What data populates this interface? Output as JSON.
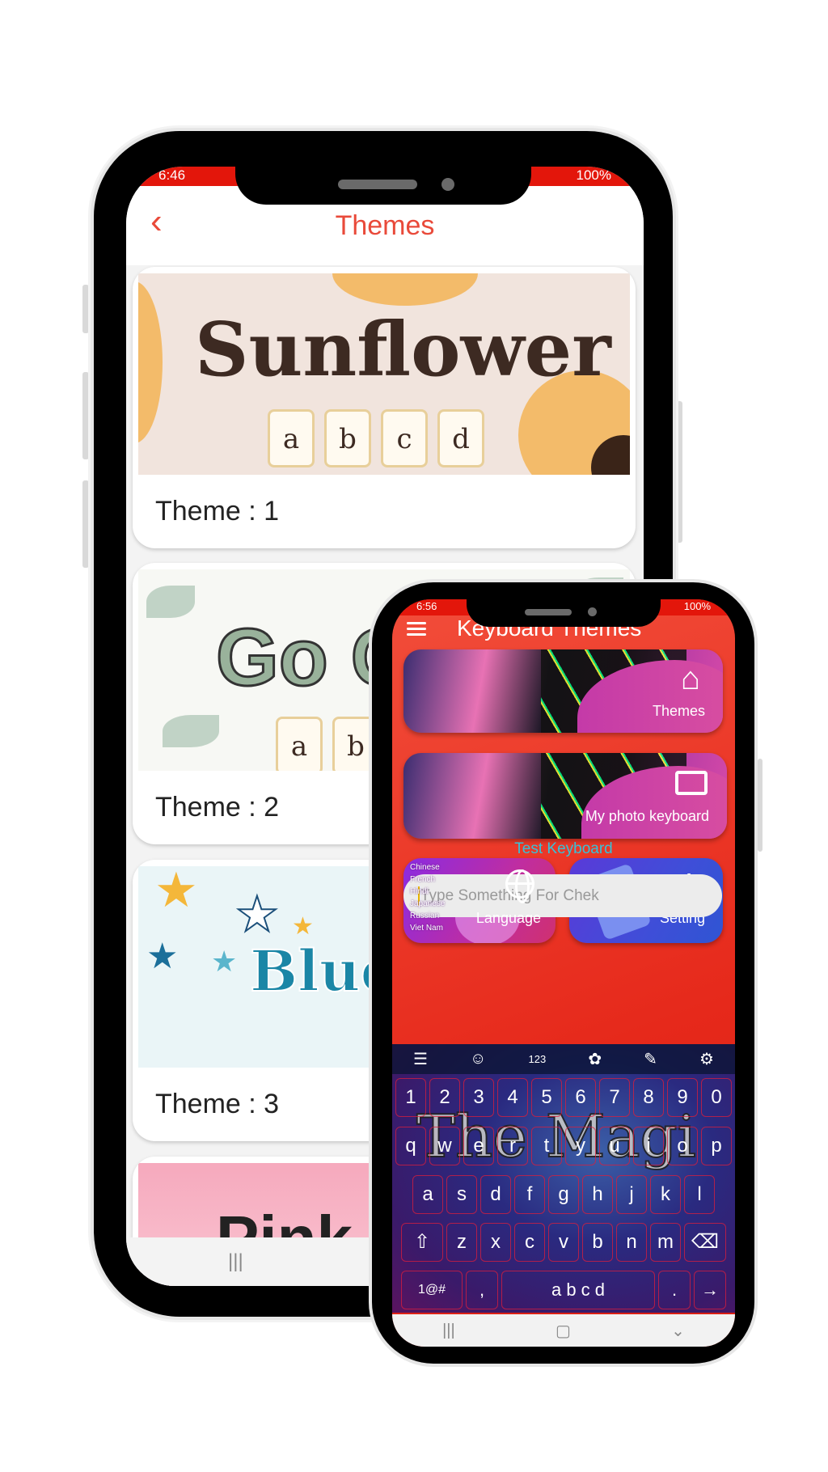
{
  "back_phone": {
    "status": {
      "time": "6:46",
      "battery": "100%"
    },
    "header": {
      "title": "Themes",
      "back_icon": "chevron-left-icon"
    },
    "themes": [
      {
        "label": "Theme : 1",
        "preview_title": "Sunflower",
        "preview_keys": [
          "a",
          "b",
          "c",
          "d"
        ]
      },
      {
        "label": "Theme : 2",
        "preview_title": "Go G",
        "preview_keys": [
          "a",
          "b"
        ]
      },
      {
        "label": "Theme : 3",
        "preview_title": "Blue",
        "preview_keys": []
      },
      {
        "label": "",
        "preview_title": "Pink",
        "preview_keys": []
      }
    ],
    "nav": {
      "recents": "|||"
    },
    "accent": "#e94a3a"
  },
  "front_phone": {
    "status": {
      "time": "6:56",
      "battery": "100%"
    },
    "header": {
      "title": "Keyboard Themes"
    },
    "menu": {
      "themes": "Themes",
      "photo": "My photo keyboard",
      "language": "Language",
      "setting": "Setting",
      "language_list": [
        "Chinese",
        "French",
        "Hindi",
        "Japanese",
        "Russian",
        "Viet Nam"
      ]
    },
    "test_label": "Test Keyboard",
    "input_placeholder": "Type Something For Chek",
    "keyboard": {
      "toolbar": {
        "numbers": "123"
      },
      "theme_text": "The Magi",
      "rows": [
        [
          "1",
          "2",
          "3",
          "4",
          "5",
          "6",
          "7",
          "8",
          "9",
          "0"
        ],
        [
          "q",
          "w",
          "e",
          "r",
          "t",
          "y",
          "u",
          "i",
          "o",
          "p"
        ],
        [
          "a",
          "s",
          "d",
          "f",
          "g",
          "h",
          "j",
          "k",
          "l"
        ],
        [
          "⇧",
          "z",
          "x",
          "c",
          "v",
          "b",
          "n",
          "m",
          "⌫"
        ],
        [
          "1@#",
          ",",
          "a b c d",
          ".",
          "→"
        ]
      ]
    },
    "accent": "#e6291b",
    "test_color": "#36c2d8"
  }
}
